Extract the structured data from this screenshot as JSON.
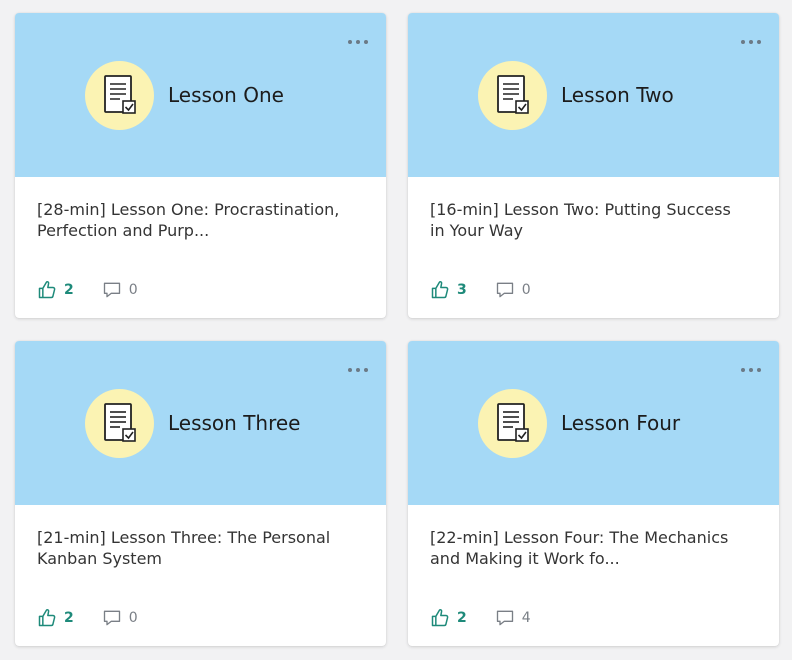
{
  "cards": [
    {
      "banner_title": "Lesson One",
      "desc_line1": "[28-min] Lesson One: Procrastination,",
      "desc_line2": "Perfection and Purp...",
      "likes": "2",
      "comments": "0"
    },
    {
      "banner_title": "Lesson Two",
      "desc_line1": "[16-min] Lesson Two: Putting Success",
      "desc_line2": "in Your Way",
      "likes": "3",
      "comments": "0"
    },
    {
      "banner_title": "Lesson Three",
      "desc_line1": "[21-min] Lesson Three: The Personal",
      "desc_line2": "Kanban System",
      "likes": "2",
      "comments": "0"
    },
    {
      "banner_title": "Lesson Four",
      "desc_line1": "[22-min] Lesson Four: The Mechanics",
      "desc_line2": "and Making it Work fo...",
      "likes": "2",
      "comments": "4"
    }
  ],
  "icons": {
    "menu": "more-horizontal-icon",
    "badge": "document-check-icon",
    "like": "thumbs-up-icon",
    "comment": "speech-bubble-icon"
  },
  "colors": {
    "banner": "#a5d9f6",
    "badge": "#fbf3b3",
    "like_accent": "#1e8a7a",
    "comment_gray": "#7a7f86"
  }
}
